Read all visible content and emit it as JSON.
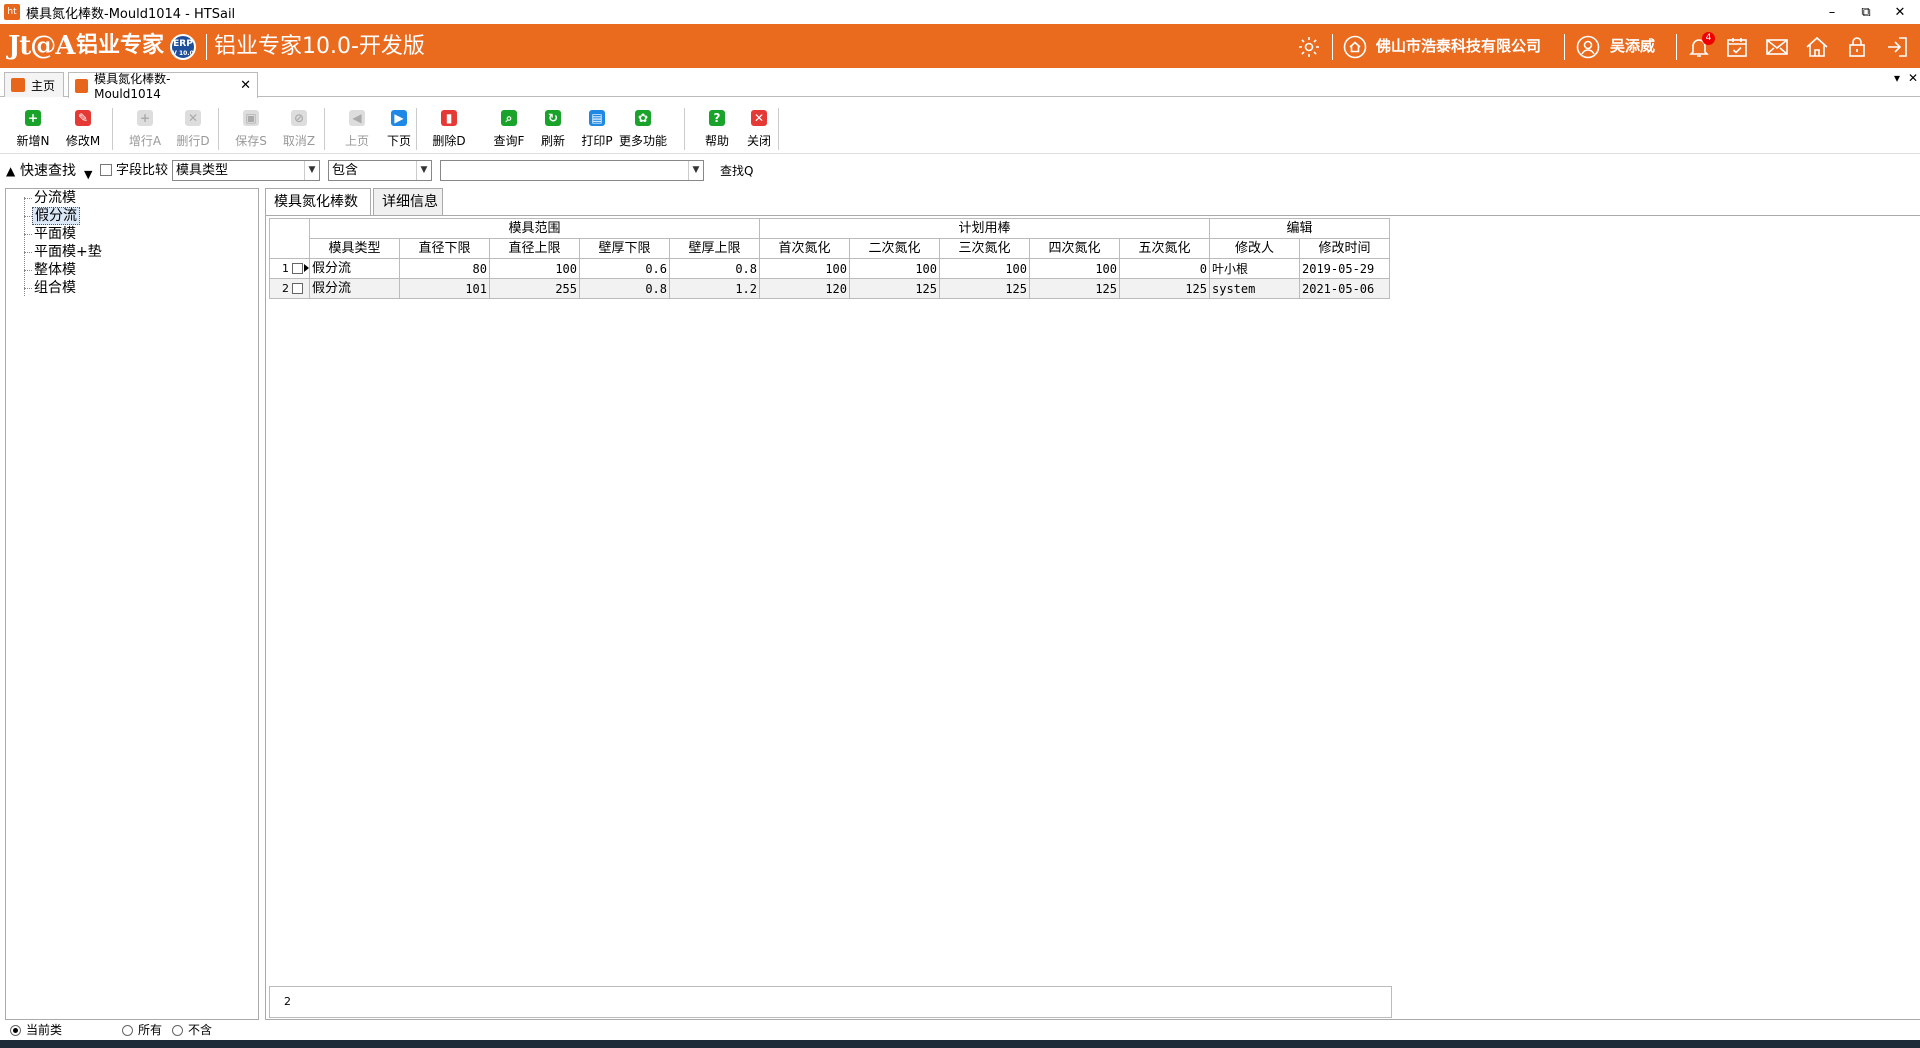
{
  "window": {
    "title": "模具氮化棒数-Mould1014 - HTSail",
    "app_icon_label": "ht",
    "min": "–",
    "restore": "⧉",
    "close": "✕"
  },
  "banner": {
    "logo": "Jt@A",
    "brand": "铝业专家",
    "erp_badge_top": "ERP",
    "erp_badge_bottom": "V 10.0",
    "product": "铝业专家10.0-开发版",
    "company": "佛山市浩泰科技有限公司",
    "user": "吴添威",
    "notification_count": "4"
  },
  "tabs": [
    {
      "label": "主页"
    },
    {
      "label": "模具氮化棒数-Mould1014",
      "close": "✕"
    }
  ],
  "tab_controls": {
    "dropdown": "▾",
    "close": "✕"
  },
  "toolbar": {
    "buttons": [
      {
        "label": "新增N",
        "icon": "+",
        "color": "#1aa32a"
      },
      {
        "label": "修改M",
        "icon": "✎",
        "color": "#e53935"
      },
      {
        "label": "增行A",
        "icon": "+",
        "color": "#cccccc"
      },
      {
        "label": "删行D",
        "icon": "✕",
        "color": "#cccccc"
      },
      {
        "label": "保存S",
        "icon": "▣",
        "color": "#cccccc"
      },
      {
        "label": "取消Z",
        "icon": "⊘",
        "color": "#cccccc"
      },
      {
        "label": "上页",
        "icon": "◀",
        "color": "#cccccc"
      },
      {
        "label": "下页",
        "icon": "▶",
        "color": "#1e88e5"
      },
      {
        "label": "删除D",
        "icon": "▮",
        "color": "#e53935"
      },
      {
        "label": "查询F",
        "icon": "⌕",
        "color": "#1aa32a"
      },
      {
        "label": "刷新",
        "icon": "↻",
        "color": "#1aa32a"
      },
      {
        "label": "打印P",
        "icon": "▤",
        "color": "#1e88e5"
      },
      {
        "label": "更多功能",
        "icon": "✿",
        "color": "#1aa32a"
      },
      {
        "label": "帮助",
        "icon": "?",
        "color": "#1aa32a"
      },
      {
        "label": "关闭",
        "icon": "✕",
        "color": "#e53935"
      }
    ]
  },
  "search": {
    "quick_label": "快速查找",
    "field_compare": "字段比较",
    "field": "模具类型",
    "operator": "包含",
    "value": "",
    "button": "查找Q"
  },
  "tree": {
    "items": [
      "分流模",
      "假分流",
      "平面模",
      "平面模+垫",
      "整体模",
      "组合模"
    ],
    "selected": "假分流"
  },
  "panel_tabs": [
    {
      "label": "模具氮化棒数"
    },
    {
      "label": "详细信息"
    }
  ],
  "grid": {
    "groups": [
      "模具范围",
      "计划用棒",
      "编辑"
    ],
    "columns": [
      "模具类型",
      "直径下限",
      "直径上限",
      "壁厚下限",
      "壁厚上限",
      "首次氮化",
      "二次氮化",
      "三次氮化",
      "四次氮化",
      "五次氮化",
      "修改人",
      "修改时间"
    ],
    "rows": [
      {
        "no": "1",
        "cells": [
          "假分流",
          "80",
          "100",
          "0.6",
          "0.8",
          "100",
          "100",
          "100",
          "100",
          "0",
          "叶小根",
          "2019-05-29"
        ]
      },
      {
        "no": "2",
        "cells": [
          "假分流",
          "101",
          "255",
          "0.8",
          "1.2",
          "120",
          "125",
          "125",
          "125",
          "125",
          "system",
          "2021-05-06"
        ]
      }
    ],
    "footer_count": "2"
  },
  "status": {
    "radios": [
      {
        "label": "当前类",
        "checked": true
      },
      {
        "label": "所有",
        "checked": false
      },
      {
        "label": "不含",
        "checked": false
      }
    ]
  }
}
